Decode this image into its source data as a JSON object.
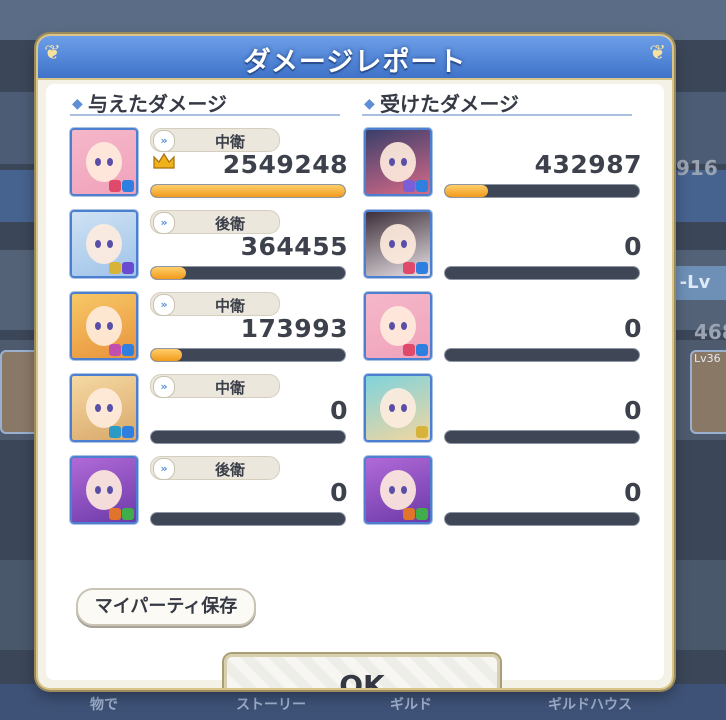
{
  "dialog": {
    "title": "ダメージレポート",
    "dealt_header": "与えたダメージ",
    "taken_header": "受けたダメージ",
    "party_save_label": "マイパーティ保存",
    "ok_label": "OK"
  },
  "dealt": [
    {
      "position": "中衛",
      "damage": "2549248",
      "fill_fraction": 1.0,
      "top": true,
      "portrait_colors": [
        "#f5b7c9",
        "#f0a3bb"
      ],
      "icons": [
        "#e04a6a",
        "#2f7fe0"
      ]
    },
    {
      "position": "後衛",
      "damage": "364455",
      "fill_fraction": 0.18,
      "top": false,
      "portrait_colors": [
        "#cfe2f3",
        "#9fc3ea"
      ],
      "icons": [
        "#d8b33a",
        "#6a4bd0"
      ]
    },
    {
      "position": "中衛",
      "damage": "173993",
      "fill_fraction": 0.16,
      "top": false,
      "portrait_colors": [
        "#f7c866",
        "#e8933c"
      ],
      "icons": [
        "#c24fb0",
        "#2f7fe0"
      ]
    },
    {
      "position": "中衛",
      "damage": "0",
      "fill_fraction": 0,
      "top": false,
      "portrait_colors": [
        "#f5d9a3",
        "#d9a86a"
      ],
      "icons": [
        "#2a9ac6",
        "#2f7fe0"
      ]
    },
    {
      "position": "後衛",
      "damage": "0",
      "fill_fraction": 0,
      "top": false,
      "portrait_colors": [
        "#b06ad8",
        "#6c3aa8"
      ],
      "icons": [
        "#e0742a",
        "#3fae4a"
      ]
    }
  ],
  "taken": [
    {
      "damage": "432987",
      "fill_fraction": 0.22,
      "portrait_colors": [
        "#3a3f6a",
        "#d86a88"
      ],
      "icons": [
        "#7a5fd6",
        "#2f7fe0"
      ]
    },
    {
      "damage": "0",
      "fill_fraction": 0,
      "portrait_colors": [
        "#3e2f3a",
        "#e8e2e6"
      ],
      "icons": [
        "#e04a6a",
        "#2f7fe0"
      ]
    },
    {
      "damage": "0",
      "fill_fraction": 0,
      "portrait_colors": [
        "#f5b7c9",
        "#f0a3bb"
      ],
      "icons": [
        "#e04a6a",
        "#2f7fe0"
      ]
    },
    {
      "damage": "0",
      "fill_fraction": 0,
      "portrait_colors": [
        "#7fd3dc",
        "#f2d6a0"
      ],
      "icons": [
        "#d8b33a"
      ]
    },
    {
      "damage": "0",
      "fill_fraction": 0,
      "portrait_colors": [
        "#b06ad8",
        "#6c3aa8"
      ],
      "icons": [
        "#e0742a",
        "#3fae4a"
      ]
    }
  ],
  "background": {
    "num1": "916",
    "num2": "468",
    "lv_label": "-Lv",
    "card_lv": "Lv36",
    "menu": [
      "物で",
      "ストーリー",
      "ギルド",
      "ギルドハウス"
    ]
  },
  "colors": {
    "accent_blue": "#3f73c9",
    "bar_fill": "#f19a1c",
    "bar_empty": "#3f4656",
    "frame_gold": "#d9c589"
  }
}
